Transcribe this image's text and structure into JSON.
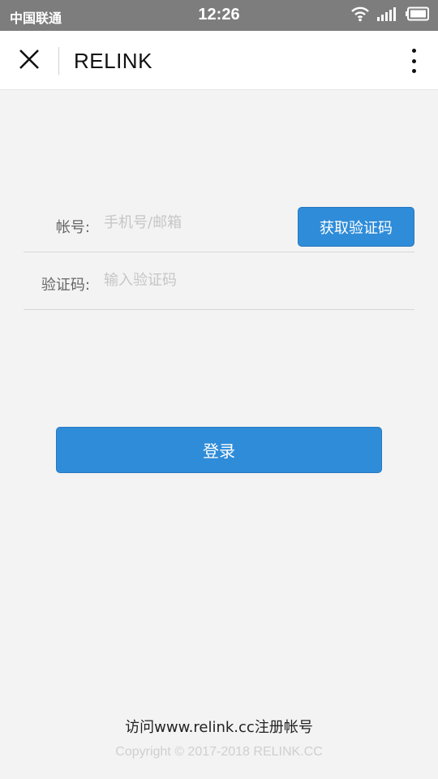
{
  "status_bar": {
    "carrier": "中国联通",
    "time": "12:26",
    "icons": [
      "wifi-icon",
      "signal-icon",
      "battery-icon"
    ]
  },
  "header": {
    "title": "RELINK",
    "close_icon": "close-icon",
    "more_icon": "more-vertical-icon"
  },
  "form": {
    "account": {
      "label": "帐号:",
      "value": "",
      "placeholder": "手机号/邮箱"
    },
    "get_code_label": "获取验证码",
    "code": {
      "label": "验证码:",
      "value": "",
      "placeholder": "输入验证码"
    },
    "login_label": "登录"
  },
  "footer": {
    "register_note": "访问www.relink.cc注册帐号",
    "copyright": "Copyright © 2017-2018 RELINK.CC"
  },
  "colors": {
    "accent": "#2f8cd8",
    "status_bar": "#7d7d7d",
    "background": "#f3f3f3"
  }
}
